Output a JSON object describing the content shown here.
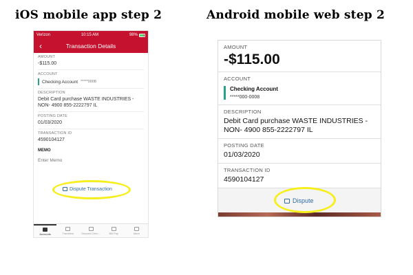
{
  "headings": {
    "ios": "iOS mobile app step 2",
    "android": "Android mobile web step 2"
  },
  "ios": {
    "status_bar": {
      "carrier": "Verizon",
      "time": "10:15 AM",
      "battery": "98%"
    },
    "nav_title": "Transaction Details",
    "amount_label": "AMOUNT",
    "amount": "-$115.00",
    "account_label": "ACCOUNT",
    "account_name": "Checking Account",
    "account_mask": "*****0008",
    "description_label": "DESCRIPTION",
    "description": "Debit Card purchase WASTE INDUSTRIES - NON- 4900 855-2222797 IL",
    "posting_label": "POSTING DATE",
    "posting_date": "01/03/2020",
    "txn_label": "TRANSACTION ID",
    "txn_id": "4590104127",
    "memo_label": "MEMO",
    "memo_placeholder": "Enter Memo",
    "dispute_label": "Dispute Transaction",
    "tabs": [
      "Accounts",
      "Transfers",
      "Deposit Chec...",
      "Bill Pay",
      "More"
    ]
  },
  "android": {
    "amount_label": "AMOUNT",
    "amount": "-$115.00",
    "account_label": "ACCOUNT",
    "account_name": "Checking Account",
    "account_mask": "*****000-0008",
    "description_label": "DESCRIPTION",
    "description": "Debit Card purchase WASTE INDUSTRIES - NON- 4900 855-2222797 IL",
    "posting_label": "POSTING DATE",
    "posting_date": "01/03/2020",
    "txn_label": "TRANSACTION ID",
    "txn_id": "4590104127",
    "dispute_label": "Dispute"
  },
  "colors": {
    "brand_red": "#c4122f",
    "account_accent": "#2aa189",
    "link_blue": "#2f6aa7",
    "highlight_yellow": "#f7ee1e"
  }
}
